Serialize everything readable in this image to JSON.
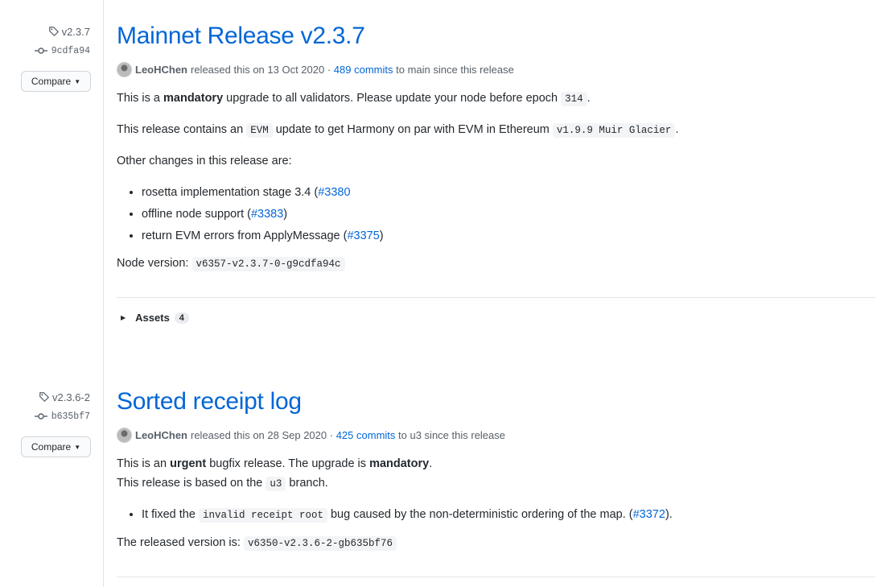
{
  "releases": [
    {
      "tag": "v2.3.7",
      "commit": "9cdfa94",
      "compare_label": "Compare",
      "title": "Mainnet Release v2.3.7",
      "author": "LeoHChen",
      "released_prefix": "released this on 13 Oct 2020 ·",
      "commits_link": "489 commits",
      "since_text": "to main since this release",
      "p1_a": "This is a ",
      "p1_bold": "mandatory",
      "p1_b": " upgrade to all validators. Please update your node before epoch ",
      "p1_code": "314",
      "p1_c": ".",
      "p2_a": "This release contains an ",
      "p2_code1": "EVM",
      "p2_b": " update to get Harmony on par with EVM in Ethereum ",
      "p2_code2": "v1.9.9 Muir Glacier",
      "p2_c": ".",
      "p3": "Other changes in this release are:",
      "items": [
        {
          "text": "rosetta implementation stage 3.4 (",
          "link": "#3380",
          "end": ""
        },
        {
          "text": "offline node support (",
          "link": "#3383",
          "end": ")"
        },
        {
          "text": "return EVM errors from ApplyMessage (",
          "link": "#3375",
          "end": ")"
        }
      ],
      "node_label": "Node version:",
      "node_code": "v6357-v2.3.7-0-g9cdfa94c",
      "assets_label": "Assets",
      "assets_count": "4"
    },
    {
      "tag": "v2.3.6-2",
      "commit": "b635bf7",
      "compare_label": "Compare",
      "title": "Sorted receipt log",
      "author": "LeoHChen",
      "released_prefix": "released this on 28 Sep 2020 ·",
      "commits_link": "425 commits",
      "since_text": "to u3 since this release",
      "p1_a": "This is an ",
      "p1_bold": "urgent",
      "p1_b": " bugfix release. The upgrade is ",
      "p1_bold2": "mandatory",
      "p1_c": ".",
      "p2_a": "This release is based on the ",
      "p2_code": "u3",
      "p2_b": " branch.",
      "item_a": "It fixed the ",
      "item_code": "invalid receipt root",
      "item_b": " bug caused by the non-deterministic ordering of the map. (",
      "item_link": "#3372",
      "item_c": ").",
      "ver_label": "The released version is:",
      "ver_code": "v6350-v2.3.6-2-gb635bf76"
    }
  ]
}
